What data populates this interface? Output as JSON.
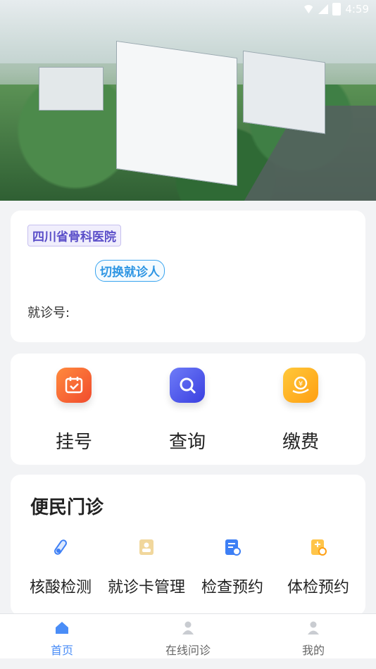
{
  "status_bar": {
    "time": "4:59"
  },
  "patient_card": {
    "hospital_name": "四川省骨科医院",
    "switch_label": "切换就诊人",
    "visit_number_label": "就诊号:"
  },
  "quick_functions": [
    {
      "label": "挂号",
      "icon": "calendar-icon"
    },
    {
      "label": "查询",
      "icon": "search-icon"
    },
    {
      "label": "缴费",
      "icon": "payment-icon"
    }
  ],
  "services": {
    "title": "便民门诊",
    "items": [
      {
        "label": "核酸检测",
        "icon": "test-tube-icon"
      },
      {
        "label": "就诊卡管理",
        "icon": "id-card-icon"
      },
      {
        "label": "检查预约",
        "icon": "report-clock-icon"
      },
      {
        "label": "体检预约",
        "icon": "medical-doc-icon"
      }
    ]
  },
  "tabbar": {
    "items": [
      {
        "label": "首页",
        "icon": "home-icon",
        "active": true
      },
      {
        "label": "在线问诊",
        "icon": "doctor-icon",
        "active": false
      },
      {
        "label": "我的",
        "icon": "user-icon",
        "active": false
      }
    ]
  },
  "colors": {
    "accent": "#4a8df7",
    "hospital_tag": "#5b4fc9",
    "switch_button": "#2d95e3"
  }
}
